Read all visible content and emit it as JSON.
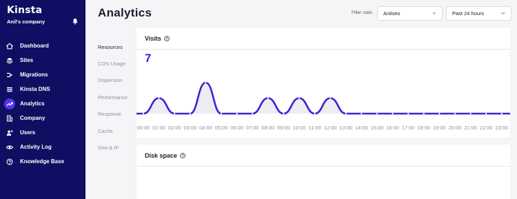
{
  "brand": {
    "logo_text": "Kinsta",
    "company": "Anil's company"
  },
  "sidebar": {
    "items": [
      {
        "label": "Dashboard",
        "icon": "home-icon",
        "active": false
      },
      {
        "label": "Sites",
        "icon": "layers-icon",
        "active": false
      },
      {
        "label": "Migrations",
        "icon": "migrate-icon",
        "active": false
      },
      {
        "label": "Kinsta DNS",
        "icon": "dns-icon",
        "active": false
      },
      {
        "label": "Analytics",
        "icon": "trend-icon",
        "active": true
      },
      {
        "label": "Company",
        "icon": "building-icon",
        "active": false
      },
      {
        "label": "Users",
        "icon": "add-user-icon",
        "active": false
      },
      {
        "label": "Activity Log",
        "icon": "eye-icon",
        "active": false
      },
      {
        "label": "Knowledge Base",
        "icon": "help-icon",
        "active": false
      }
    ]
  },
  "header": {
    "title": "Analytics",
    "filter_label": "Filter stats",
    "site_select": "Anilseo",
    "range_select": "Past 24 hours"
  },
  "subnav": {
    "items": [
      "Resources",
      "CDN Usage",
      "Dispersion",
      "Performance",
      "Response",
      "Cache",
      "Geo & IP"
    ],
    "active_index": 0
  },
  "visits": {
    "title": "Visits",
    "total": "7"
  },
  "disk": {
    "title": "Disk space"
  },
  "colors": {
    "sidebar": "#0e0e62",
    "accent": "#3f1fd6",
    "active_icon_bg": "#5333ed"
  },
  "chart_data": {
    "type": "area",
    "x": [
      "00:00",
      "01:00",
      "02:00",
      "03:00",
      "04:00",
      "05:00",
      "06:00",
      "07:00",
      "08:00",
      "09:00",
      "10:00",
      "11:00",
      "12:00",
      "13:00",
      "14:00",
      "15:00",
      "16:00",
      "17:00",
      "18:00",
      "19:00",
      "20:00",
      "21:00",
      "22:00",
      "23:00"
    ],
    "values": [
      0,
      1,
      0,
      0,
      2,
      0,
      0,
      0,
      1,
      0,
      1,
      0,
      1,
      0,
      0,
      0,
      0,
      0,
      0,
      0,
      0,
      0,
      0,
      0
    ],
    "ylim": [
      0,
      2
    ],
    "grid": false
  }
}
